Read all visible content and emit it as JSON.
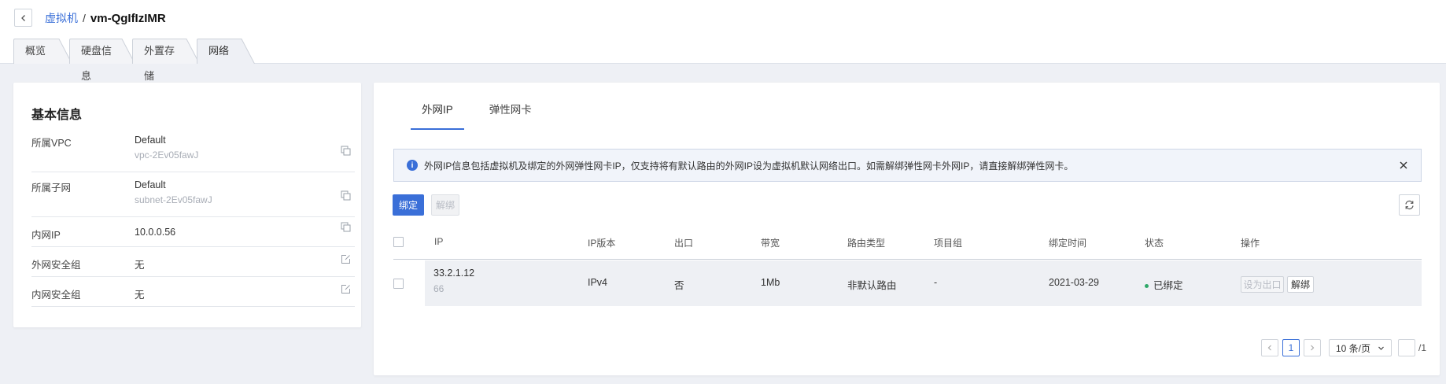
{
  "breadcrumb": {
    "parent": "虚拟机",
    "separator": "/",
    "current": "vm-QgIfIzIMR"
  },
  "tabs": [
    {
      "label": "概览",
      "active": false
    },
    {
      "label": "硬盘信息",
      "active": false
    },
    {
      "label": "外置存储",
      "active": false
    },
    {
      "label": "网络",
      "active": true
    }
  ],
  "basic_info": {
    "title": "基本信息",
    "rows": [
      {
        "label": "所属VPC",
        "value": "Default",
        "sub": "vpc-2Ev05fawJ",
        "icon": "copy-icon"
      },
      {
        "label": "所属子网",
        "value": "Default",
        "sub": "subnet-2Ev05fawJ",
        "icon": "copy-icon"
      },
      {
        "label": "内网IP",
        "value": "10.0.0.56",
        "icon": "copy-icon"
      },
      {
        "label": "外网安全组",
        "value": "无",
        "icon": "edit-icon"
      },
      {
        "label": "内网安全组",
        "value": "无",
        "icon": "edit-icon"
      }
    ]
  },
  "sub_tabs": [
    {
      "label": "外网IP",
      "active": true
    },
    {
      "label": "弹性网卡",
      "active": false
    }
  ],
  "notice": "外网IP信息包括虚拟机及绑定的外网弹性网卡IP，仅支持将有默认路由的外网IP设为虚拟机默认网络出口。如需解绑弹性网卡外网IP，请直接解绑弹性网卡。",
  "toolbar": {
    "bind_label": "绑定",
    "unbind_label": "解绑"
  },
  "table": {
    "headers": [
      "IP",
      "IP版本",
      "出口",
      "带宽",
      "路由类型",
      "项目组",
      "绑定时间",
      "状态",
      "操作"
    ],
    "rows": [
      {
        "ip": "33.2.1.12",
        "ip_sub": "66",
        "version": "IPv4",
        "egress": "否",
        "bandwidth": "1Mb",
        "route_type": "非默认路由",
        "project": "-",
        "bind_time": "2021-03-29",
        "status": "已绑定",
        "status_color": "#2ea868",
        "actions": {
          "set_egress": "设为出口",
          "unbind": "解绑"
        }
      }
    ]
  },
  "pagination": {
    "current_page": "1",
    "page_size": "10 条/页",
    "total_pages": "/1"
  },
  "colors": {
    "accent": "#3a6fd8",
    "success": "#2ea868"
  }
}
